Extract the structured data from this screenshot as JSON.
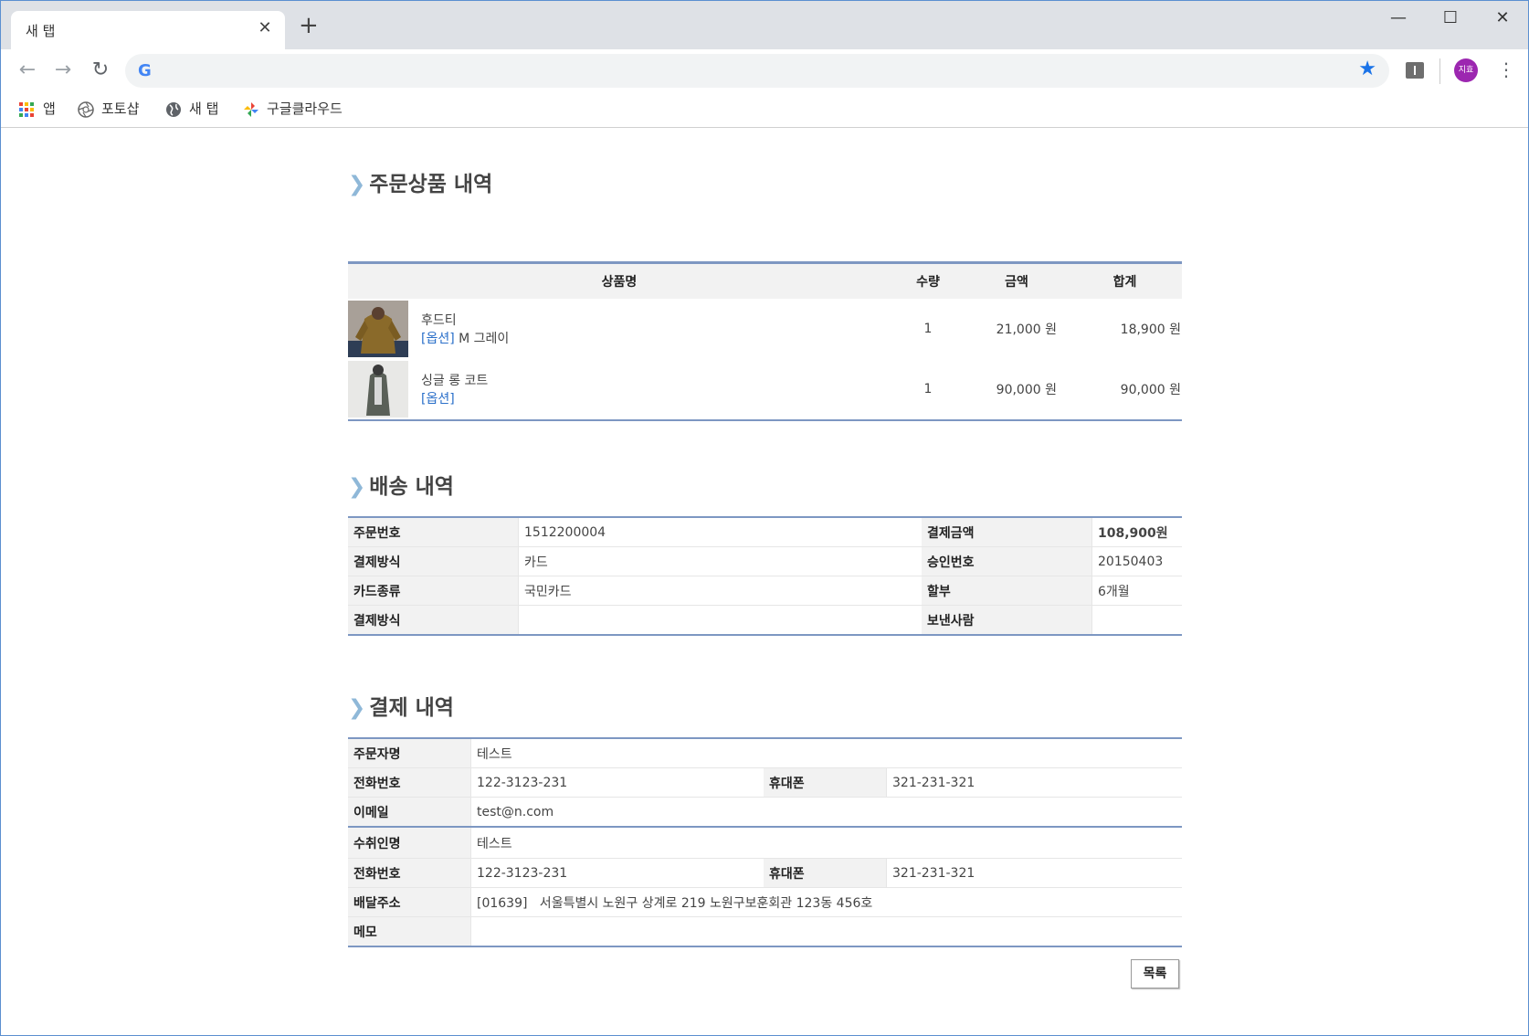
{
  "browser": {
    "tab_title": "새 탭",
    "tab_close": "✕",
    "new_tab": "+",
    "window_controls": {
      "minimize": "—",
      "maximize": "☐",
      "close": "✕"
    },
    "nav": {
      "back": "←",
      "forward": "→",
      "reload": "↻"
    },
    "omnibox_logo": "G",
    "star": "★",
    "profile_initials": "지효",
    "menu": "⋮",
    "bookmarks": [
      {
        "label": "앱",
        "icon": "apps-grid-icon"
      },
      {
        "label": "포토샵",
        "icon": "aperture-icon"
      },
      {
        "label": "새 탭",
        "icon": "globe-icon"
      },
      {
        "label": "구글클라우드",
        "icon": "pinwheel-icon"
      }
    ]
  },
  "order_items": {
    "title": "주문상품 내역",
    "headers": {
      "name": "상품명",
      "qty": "수량",
      "price": "금액",
      "total": "합계"
    },
    "rows": [
      {
        "name": "후드티",
        "option_label": "[옵션]",
        "option_value": " M 그레이",
        "qty": "1",
        "price": "21,000 원",
        "total": "18,900 원"
      },
      {
        "name": "싱글 롱 코트",
        "option_label": "[옵션]",
        "option_value": "",
        "qty": "1",
        "price": "90,000 원",
        "total": "90,000 원"
      }
    ]
  },
  "shipping": {
    "title": "배송 내역",
    "rows": [
      {
        "l1": "주문번호",
        "v1": "1512200004",
        "l2": "결제금액",
        "v2": "108,900원"
      },
      {
        "l1": "결제방식",
        "v1": "카드",
        "l2": "승인번호",
        "v2": "20150403"
      },
      {
        "l1": "카드종류",
        "v1": "국민카드",
        "l2": "할부",
        "v2": "6개월"
      },
      {
        "l1": "결제방식",
        "v1": "",
        "l2": "보낸사람",
        "v2": ""
      }
    ]
  },
  "payment": {
    "title": "결제 내역",
    "orderer_name_label": "주문자명",
    "orderer_name": "테스트",
    "orderer_phone_label": "전화번호",
    "orderer_phone": "122-3123-231",
    "orderer_mobile_label": "휴대폰",
    "orderer_mobile": "321-231-321",
    "email_label": "이메일",
    "email": "test@n.com",
    "recipient_name_label": "수취인명",
    "recipient_name": "테스트",
    "recipient_phone_label": "전화번호",
    "recipient_phone": "122-3123-231",
    "recipient_mobile_label": "휴대폰",
    "recipient_mobile": "321-231-321",
    "address_label": "배달주소",
    "address": "[01639]   서울특별시 노원구 상계로 219 노원구보훈회관 123동 456호",
    "memo_label": "메모",
    "memo": ""
  },
  "list_button": "목록",
  "colors": {
    "accent_border": "#7d97c2",
    "amount": "#e05a00",
    "option": "#2a6fc9"
  }
}
